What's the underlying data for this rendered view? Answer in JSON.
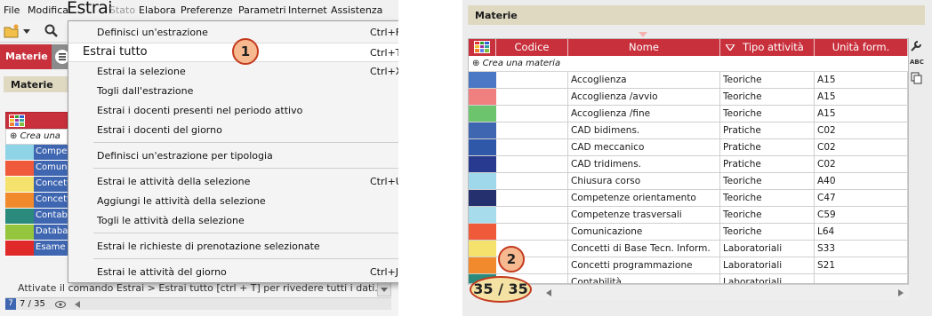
{
  "menubar": {
    "items": [
      "File",
      "Modifica",
      "Estrai",
      "Stato",
      "Elabora",
      "Preferenze",
      "Parametri",
      "Internet",
      "Assistenza"
    ]
  },
  "left_panel": {
    "tab_label": "Materie",
    "section_title": "Materie",
    "create_label": "Crea una",
    "rows": [
      {
        "label": "Compet",
        "color": "#8fd3e6"
      },
      {
        "label": "Comuni",
        "color": "#ef5a3a"
      },
      {
        "label": "Concett",
        "color": "#f5e26c"
      },
      {
        "label": "Concett",
        "color": "#f08a2c"
      },
      {
        "label": "Contabi",
        "color": "#2a8a7c"
      },
      {
        "label": "Databas",
        "color": "#95c53c"
      },
      {
        "label": "Esame",
        "color": "#e02a2a"
      }
    ],
    "hint": "Attivate il comando Estrai > Estrai tutto [ctrl + T] per rivedere tutti i dati.",
    "status_count": "7 / 35",
    "status_num": "7"
  },
  "menu": {
    "items": [
      {
        "label": "Definisci un'estrazione",
        "shortcut": "Ctrl+F"
      },
      {
        "label": "Estrai tutto",
        "shortcut": "Ctrl+T"
      },
      {
        "label": "Estrai la selezione",
        "shortcut": "Ctrl+X"
      },
      {
        "label": "Togli dall'estrazione",
        "shortcut": ""
      },
      {
        "label": "Estrai i docenti presenti nel periodo attivo",
        "shortcut": ""
      },
      {
        "label": "Estrai i docenti del giorno",
        "shortcut": ""
      },
      {
        "label": "Definisci un'estrazione per tipologia",
        "shortcut": ""
      },
      {
        "label": "Estrai le attività della selezione",
        "shortcut": "Ctrl+U"
      },
      {
        "label": "Aggiungi le attività della selezione",
        "shortcut": ""
      },
      {
        "label": "Togli le attività della selezione",
        "shortcut": ""
      },
      {
        "label": "Estrai le richieste di prenotazione selezionate",
        "shortcut": ""
      },
      {
        "label": "Estrai le attività del giorno",
        "shortcut": "Ctrl+J"
      }
    ],
    "badge": "1"
  },
  "right_panel": {
    "section_title": "Materie",
    "columns": [
      "Codice",
      "Nome",
      "Tipo attività",
      "Unità form."
    ],
    "create_label": "Crea una materia",
    "rows": [
      {
        "color": "#4a78c4",
        "nome": "Accoglienza",
        "tipo": "Teoriche",
        "unita": "A15"
      },
      {
        "color": "#f08080",
        "nome": "Accoglienza /avvio",
        "tipo": "Teoriche",
        "unita": "A15"
      },
      {
        "color": "#6cc46c",
        "nome": "Accoglienza /fine",
        "tipo": "Teoriche",
        "unita": "A15"
      },
      {
        "color": "#3f66b0",
        "nome": "CAD bidimens.",
        "tipo": "Pratiche",
        "unita": "C02"
      },
      {
        "color": "#2f59a8",
        "nome": "CAD meccanico",
        "tipo": "Pratiche",
        "unita": "C02"
      },
      {
        "color": "#283a90",
        "nome": "CAD tridimens.",
        "tipo": "Pratiche",
        "unita": "C02"
      },
      {
        "color": "#9fd8ea",
        "nome": "Chiusura corso",
        "tipo": "Teoriche",
        "unita": "A40"
      },
      {
        "color": "#25306e",
        "nome": "Competenze orientamento",
        "tipo": "Teoriche",
        "unita": "C47"
      },
      {
        "color": "#a6dcec",
        "nome": "Competenze trasversali",
        "tipo": "Teoriche",
        "unita": "C59"
      },
      {
        "color": "#ef5a3a",
        "nome": "Comunicazione",
        "tipo": "Teoriche",
        "unita": "L64"
      },
      {
        "color": "#f5e26c",
        "nome": "Concetti di Base Tecn. Inform.",
        "tipo": "Laboratoriali",
        "unita": "S33"
      },
      {
        "color": "#f08a2c",
        "nome": "Concetti programmazione",
        "tipo": "Laboratoriali",
        "unita": "S21"
      },
      {
        "color": "#2a8a7c",
        "nome": "Contabilità",
        "tipo": "Laboratoriali",
        "unita": ""
      }
    ],
    "count": "35 / 35",
    "badge": "2"
  }
}
